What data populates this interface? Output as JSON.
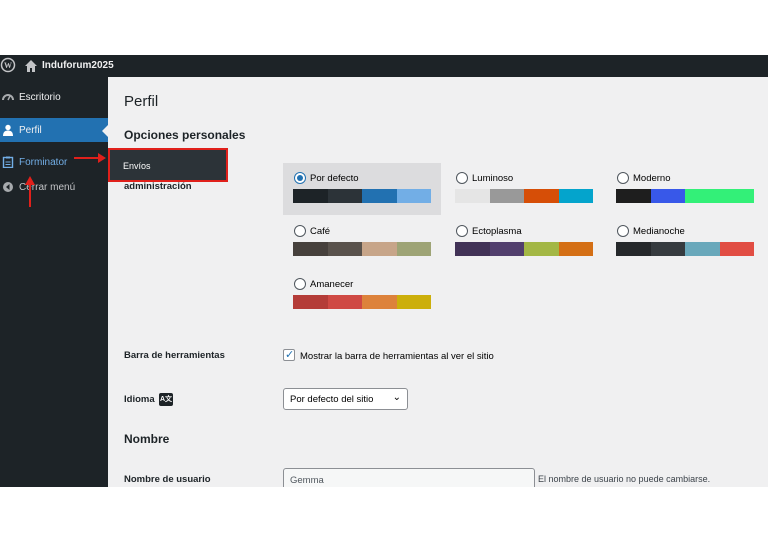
{
  "admin_bar": {
    "site_name": "Induforum2025",
    "wp_icon": "wordpress-logo-icon",
    "home_icon": "home-icon"
  },
  "sidebar": {
    "items": [
      {
        "label": "Escritorio",
        "icon": "dashboard-icon"
      },
      {
        "label": "Perfil",
        "icon": "user-icon"
      },
      {
        "label": "Forminator",
        "icon": "forminator-icon"
      },
      {
        "label": "Cerrar menú",
        "icon": "collapse-icon"
      }
    ],
    "flyout": {
      "label": "Envíos"
    }
  },
  "page": {
    "title": "Perfil",
    "section_personal": "Opciones personales",
    "color_scheme_label": "administración",
    "schemes": [
      {
        "name": "Por defecto",
        "selected": true,
        "colors": [
          "#1d2327",
          "#2c3338",
          "#2271b1",
          "#72aee6"
        ]
      },
      {
        "name": "Luminoso",
        "selected": false,
        "colors": [
          "#e5e5e5",
          "#999999",
          "#d64e07",
          "#04a4cc"
        ]
      },
      {
        "name": "Moderno",
        "selected": false,
        "colors": [
          "#1e1e1e",
          "#3858e9",
          "#33f078",
          "#33f078"
        ]
      },
      {
        "name": "Café",
        "selected": false,
        "colors": [
          "#46403c",
          "#59524c",
          "#c7a589",
          "#9ea476"
        ]
      },
      {
        "name": "Ectoplasma",
        "selected": false,
        "colors": [
          "#413256",
          "#523f6d",
          "#a3b745",
          "#d46f15"
        ]
      },
      {
        "name": "Medianoche",
        "selected": false,
        "colors": [
          "#25282b",
          "#363b3f",
          "#69a8bb",
          "#e14d43"
        ]
      },
      {
        "name": "Amanecer",
        "selected": false,
        "colors": [
          "#b43c38",
          "#cf4944",
          "#dd823b",
          "#ccaf0b"
        ]
      }
    ],
    "toolbar_label": "Barra de herramientas",
    "toolbar_checkbox": "Mostrar la barra de herramientas al ver el sitio",
    "language_label": "Idioma",
    "language_value": "Por defecto del sitio",
    "section_name": "Nombre",
    "username_label": "Nombre de usuario",
    "username_value": "Gemma",
    "username_desc": "El nombre de usuario no puede cambiarse."
  },
  "colors": {
    "accent": "#2271b1",
    "annotation": "#e0201b",
    "sidebar_bg": "#1d2327"
  }
}
